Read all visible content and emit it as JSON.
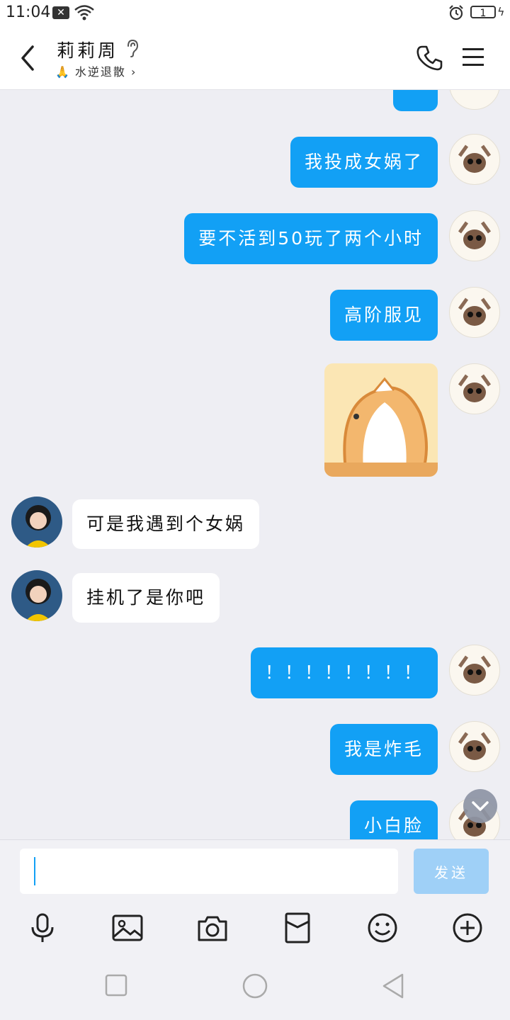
{
  "status_bar": {
    "time": "11:04",
    "battery": "1"
  },
  "header": {
    "contact_name": "莉莉周",
    "status_text": "水逆退散",
    "status_emoji": "🙏"
  },
  "messages": [
    {
      "side": "out",
      "text": "我投成女娲了"
    },
    {
      "side": "out",
      "text": "要不活到50玩了两个小时"
    },
    {
      "side": "out",
      "text": "高阶服见"
    },
    {
      "side": "out",
      "type": "sticker"
    },
    {
      "side": "in",
      "text": "可是我遇到个女娲"
    },
    {
      "side": "in",
      "text": "挂机了是你吧"
    },
    {
      "side": "out",
      "text": "！！！！！！！！"
    },
    {
      "side": "out",
      "text": "我是炸毛"
    },
    {
      "side": "out",
      "text": "小白脸"
    }
  ],
  "input": {
    "placeholder": "",
    "send_label": "发送"
  },
  "colors": {
    "bubble_out": "#12a0f5",
    "bubble_in": "#ffffff",
    "background": "#eeeef3",
    "send_disabled": "#9fd0f7"
  },
  "toolbar_icons": [
    "microphone-icon",
    "image-icon",
    "camera-icon",
    "red-packet-icon",
    "emoji-icon",
    "plus-icon"
  ],
  "nav_icons": [
    "recent-apps-icon",
    "home-icon",
    "back-icon"
  ]
}
